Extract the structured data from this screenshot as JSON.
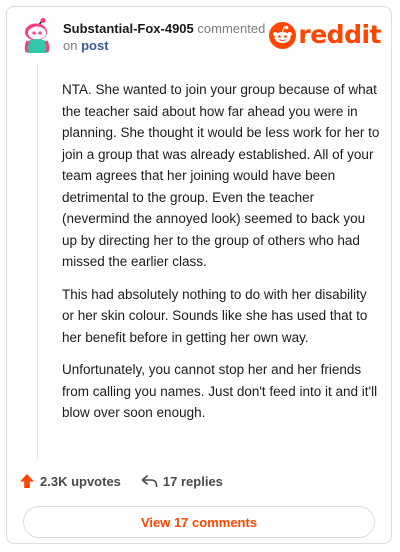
{
  "comment": {
    "username": "Substantial-Fox-4905",
    "action_text": "commented",
    "on_text": "on",
    "post_link": "post",
    "paragraphs": [
      "NTA. She wanted to join your group because of what the teacher said about how far ahead you were in planning. She thought it would be less work for her to join a group that was already established. All of your team agrees that her joining would have been detrimental to the group. Even the teacher (nevermind the annoyed look) seemed to back you up by directing her to the group of others who had missed the earlier class.",
      "This had absolutely nothing to do with her disability or her skin colour. Sounds like she has used that to her benefit before in getting her own way.",
      "Unfortunately, you cannot stop her and her friends from calling you names. Just don't feed into it and it'll blow over soon enough."
    ]
  },
  "brand": {
    "logo_text": "reddit",
    "icon": "reddit-alien-icon",
    "color": "#ff4500"
  },
  "actions": {
    "upvotes": "2.3K upvotes",
    "replies": "17 replies",
    "view_comments": "View 17 comments"
  },
  "icons": {
    "upvote": "upvote-arrow-icon",
    "reply": "reply-arrow-icon",
    "avatar": "snoo-avatar-icon"
  }
}
